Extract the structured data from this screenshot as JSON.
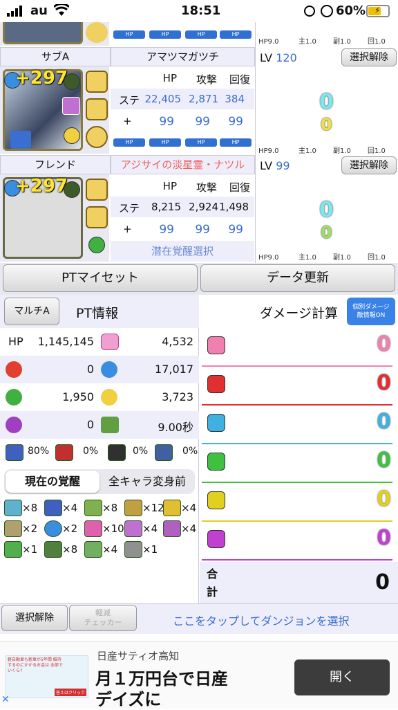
{
  "status_bar": {
    "carrier": "au",
    "time": "18:51",
    "battery": "60%"
  },
  "top_panel_footer": {
    "hp": "HP9.0",
    "main": "主1.0",
    "sub": "副1.0",
    "rcv": "回1.0"
  },
  "slots": [
    {
      "label": "サブA",
      "monster_name": "アマツマガツチ",
      "plus": "+297",
      "lv_label": "LV",
      "lv": "120",
      "clear_button": "選択解除",
      "stat_headers": [
        "HP",
        "攻撃",
        "回復"
      ],
      "stat_row_label": "ステ",
      "stats": [
        "22,405",
        "2,871",
        "384"
      ],
      "plus_row_label": "+",
      "plus_values": [
        "99",
        "99",
        "99"
      ],
      "numbers": [
        "0",
        "0"
      ],
      "footer": {
        "hp": "HP9.0",
        "main": "主1.0",
        "sub": "副1.0",
        "rcv": "回1.0"
      }
    },
    {
      "label": "フレンド",
      "monster_name": "アジサイの淡星霊・ナツル",
      "plus": "+297",
      "lv_label": "LV",
      "lv": "99",
      "clear_button": "選択解除",
      "stat_headers": [
        "HP",
        "攻撃",
        "回復"
      ],
      "stat_row_label": "ステ",
      "stats": [
        "8,215",
        "2,924",
        "1,498"
      ],
      "plus_row_label": "+",
      "plus_values": [
        "99",
        "99",
        "99"
      ],
      "numbers": [
        "0",
        "0"
      ],
      "latent_select": "潜在覚醒選択",
      "footer": {
        "hp": "HP9.0",
        "main": "主1.0",
        "sub": "副1.0",
        "rcv": "回1.0"
      }
    }
  ],
  "actions": {
    "pt_myset": "PTマイセット",
    "data_update": "データ更新"
  },
  "pt_info": {
    "multi_button": "マルチA",
    "title": "PT情報",
    "hp_label": "HP",
    "hp_value": "1,145,145",
    "heal_value": "4,532",
    "fire_value": "0",
    "water_value": "17,017",
    "wood_value": "1,950",
    "light_value": "3,723",
    "dark_value": "0",
    "time_value": "9.00秒",
    "resist": [
      "80%",
      "0%",
      "0%",
      "0%"
    ],
    "tab_current": "現在の覚醒",
    "tab_all": "全キャラ変身前",
    "awakenings_row1": [
      "×8",
      "×4",
      "×8",
      "×12",
      "×4"
    ],
    "awakenings_row2": [
      "×2",
      "×2",
      "×10",
      "×4",
      "×4"
    ],
    "awakenings_row3": [
      "×1",
      "×8",
      "×4",
      "×1"
    ]
  },
  "damage": {
    "title": "ダメージ計算",
    "badge_line1": "個別ダメージ",
    "badge_line2": "敵情報ON",
    "rows": [
      "0",
      "0",
      "0",
      "0",
      "0",
      "0"
    ],
    "row_colors": [
      "#f080b0",
      "#e03030",
      "#40b0e0",
      "#40c040",
      "#e0d020",
      "#c040d0"
    ],
    "total_label_1": "合",
    "total_label_2": "計",
    "total_value": "0"
  },
  "bottom_bar": {
    "clear_button": "選択解除",
    "reduce_line1": "軽減",
    "reduce_line2": "チェッカー",
    "dungeon_prompt": "ここをタップしてダンジョンを選択"
  },
  "ad": {
    "advertiser": "日産サティオ高知",
    "headline_1": "月１万円台で日産",
    "headline_2": "デイズに",
    "cta": "開く",
    "thumb_text": "軽自動車も新車が5年間 維持するのにかかるお金は 全部でいくら?",
    "thumb_button": "答えはクリック"
  }
}
